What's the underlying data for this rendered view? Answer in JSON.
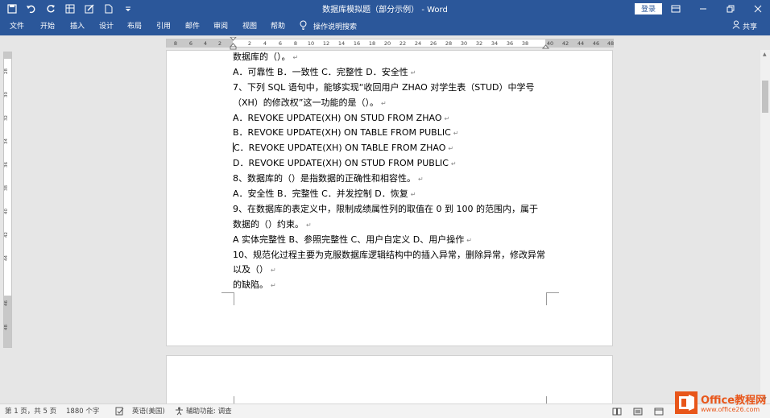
{
  "window": {
    "title": "数据库模拟题（部分示例） - Word",
    "login_label": "登录"
  },
  "ribbon": {
    "tabs": [
      "文件",
      "开始",
      "插入",
      "设计",
      "布局",
      "引用",
      "邮件",
      "审阅",
      "视图",
      "帮助"
    ],
    "tell_me": "操作说明搜索",
    "share": "共享"
  },
  "ruler": {
    "h_left": [
      "8",
      "6",
      "4",
      "2"
    ],
    "h_main": [
      "2",
      "4",
      "6",
      "8",
      "10",
      "12",
      "14",
      "16",
      "18",
      "20",
      "22",
      "24",
      "26",
      "28",
      "30",
      "32",
      "34",
      "36",
      "38"
    ],
    "h_right": [
      "40",
      "42",
      "44",
      "46",
      "48"
    ],
    "v": [
      "28",
      "30",
      "32",
      "34",
      "36",
      "38",
      "40",
      "42",
      "44",
      "46",
      "48"
    ]
  },
  "document": {
    "lines": [
      "数据库的（）。",
      "A．可靠性 B．一致性 C．完整性 D．安全性",
      "7、下列 SQL 语句中，能够实现“收回用户 ZHAO 对学生表（STUD）中学号",
      "（XH）的修改权”这一功能的是（）。",
      "A．REVOKE UPDATE(XH) ON STUD FROM ZHAO",
      "B．REVOKE UPDATE(XH) ON TABLE FROM PUBLIC",
      "C．REVOKE UPDATE(XH) ON TABLE FROM ZHAO",
      "D．REVOKE UPDATE(XH) ON STUD FROM PUBLIC",
      "8、数据库的（）是指数据的正确性和相容性。",
      "A．安全性 B．完整性 C．并发控制 D．恢复",
      "9、在数据库的表定义中，限制成绩属性列的取值在 0 到 100 的范围内，属于",
      "数据的（）约束。",
      "A 实体完整性 B、参照完整性 C、用户自定义 D、用户操作",
      "10、规范化过程主要为克服数据库逻辑结构中的插入异常，删除异常，修改异常",
      "以及（）",
      "的缺陷。"
    ],
    "paragraph_mark": "↵"
  },
  "status": {
    "page": "第 1 页，共 5 页",
    "words": "1880 个字",
    "language": "英语(美国)",
    "accessibility": "辅助功能: 调查"
  },
  "watermark": {
    "brand": "Office教程网",
    "url": "www.office26.com"
  },
  "colors": {
    "accent": "#2b579a",
    "watermark": "#e8561a"
  }
}
